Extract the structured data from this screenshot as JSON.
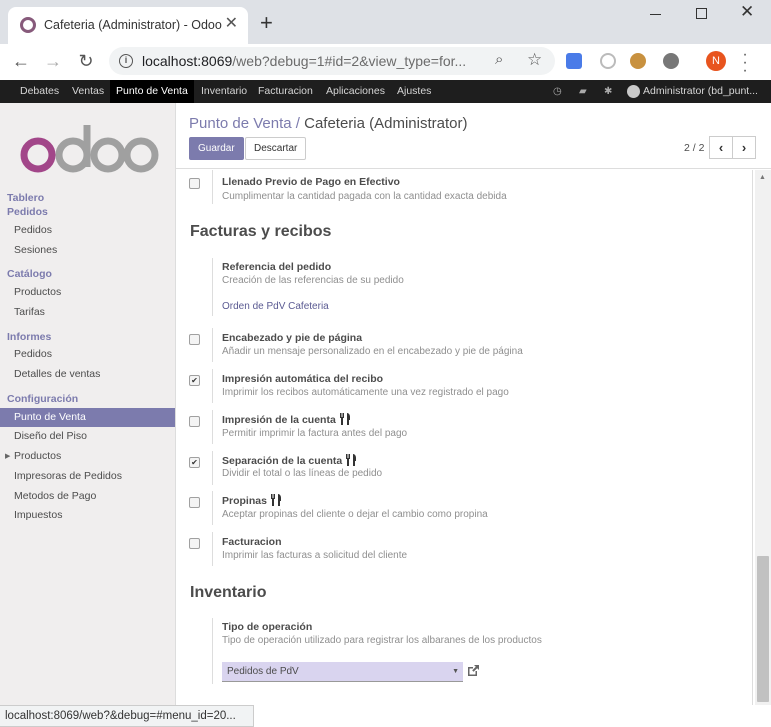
{
  "browser": {
    "tab_title": "Cafeteria (Administrator) - Odoo",
    "tab_close": "✕",
    "new_tab": "+",
    "url_host": "localhost:8069",
    "url_rest": "/web?debug=1#id=2&view_type=for...",
    "avatar_letter": "N",
    "status_url": "localhost:8069/web?&debug=#menu_id=20..."
  },
  "mainnav": {
    "items": [
      "Debates",
      "Ventas",
      "Punto de Venta",
      "Inventario",
      "Facturacion",
      "Aplicaciones",
      "Ajustes"
    ],
    "active_index": 2,
    "user": "Administrator (bd_punt..."
  },
  "sidebar": {
    "tablero": "Tablero",
    "pedidos_head": "Pedidos",
    "pedidos_items": [
      "Pedidos",
      "Sesiones"
    ],
    "catalogo_head": "Catálogo",
    "catalogo_items": [
      "Productos",
      "Tarifas"
    ],
    "informes_head": "Informes",
    "informes_items": [
      "Pedidos",
      "Detalles de ventas"
    ],
    "config_head": "Configuración",
    "config_items": [
      "Punto de Venta",
      "Diseño del Piso",
      "Productos",
      "Impresoras de Pedidos",
      "Metodos de Pago",
      "Impuestos"
    ],
    "active_item": "Punto de Venta"
  },
  "control_panel": {
    "breadcrumb_parent": "Punto de Venta /",
    "breadcrumb_current": "Cafeteria (Administrator)",
    "save_label": "Guardar",
    "discard_label": "Descartar",
    "pager": "2 / 2"
  },
  "form": {
    "llenado": {
      "title": "Llenado Previo de Pago en Efectivo",
      "desc": "Cumplimentar la cantidad pagada con la cantidad exacta debida",
      "checked": false
    },
    "facturas_section": "Facturas y recibos",
    "referencia": {
      "title": "Referencia del pedido",
      "desc": "Creación de las referencias de su pedido",
      "link": "Orden de PdV Cafeteria"
    },
    "encabezado": {
      "title": "Encabezado y pie de página",
      "desc": "Añadir un mensaje personalizado en el encabezado y pie de página",
      "checked": false
    },
    "impresion_auto": {
      "title": "Impresión automática del recibo",
      "desc": "Imprimir los recibos automáticamente una vez registrado el pago",
      "checked": true
    },
    "impresion_cuenta": {
      "title": "Impresión de la cuenta",
      "desc": "Permitir imprimir la factura antes del pago",
      "checked": false
    },
    "separacion": {
      "title": "Separación de la cuenta",
      "desc": "Dividir el total o las líneas de pedido",
      "checked": true
    },
    "propinas": {
      "title": "Propinas",
      "desc": "Aceptar propinas del cliente o dejar el cambio como propina",
      "checked": false
    },
    "facturacion": {
      "title": "Facturacion",
      "desc": "Imprimir las facturas a solicitud del cliente",
      "checked": false
    },
    "inventario_section": "Inventario",
    "tipo_operacion": {
      "title": "Tipo de operación",
      "desc": "Tipo de operación utilizado para registrar los albaranes de los productos",
      "value": "Pedidos de PdV"
    }
  },
  "colors": {
    "brand": "#7c7bad",
    "nav_bg": "#1e1e1e",
    "select_bg": "#d9d4ef"
  }
}
